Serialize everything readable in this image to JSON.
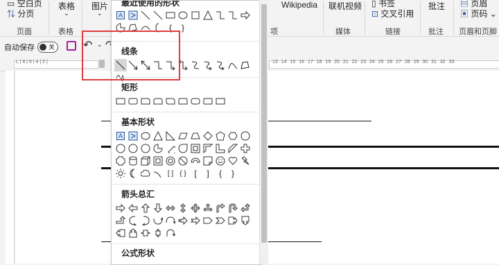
{
  "ribbon": {
    "page_group": {
      "item_top": "空白页",
      "item_split": "分页",
      "label": "页面"
    },
    "table": {
      "label_btn": "表格",
      "label": "表格"
    },
    "picture": {
      "label_btn": "图片"
    },
    "wiki": {
      "label": "Wikipedia"
    },
    "online_video": {
      "label": "联机视频",
      "group": "媒体"
    },
    "link": {
      "item_top": "书签",
      "item_cross": "交叉引用",
      "group": "链接"
    },
    "comment": {
      "label": "批注",
      "group": "批注"
    },
    "header_footer": {
      "item_top": "页眉",
      "item_page_no": "页码",
      "group": "页眉和页脚"
    },
    "items_group_label": "项"
  },
  "qat": {
    "autosave": "自动保存",
    "toggle_state": "关"
  },
  "ruler": {
    "left_ticks": "L | 8 | 6 | 4 | 2 |",
    "right_ticks": "13 14 15 16 17 18 19 20 21 22 23 24 25 26 27 28 29 30 31 32 33"
  },
  "shape_menu": {
    "sections": [
      {
        "title": "最近使用的形状"
      },
      {
        "title": "线条"
      },
      {
        "title": "矩形"
      },
      {
        "title": "基本形状"
      },
      {
        "title": "箭头总汇"
      },
      {
        "title": "公式形状"
      }
    ],
    "textbox_glyph": "A",
    "braces_glyph": "{ }",
    "brackets_glyph": "[ ]"
  },
  "colors": {
    "highlight": "#e03a3a",
    "accent": "#2b579a",
    "ribbon_bg": "#f3f3f3"
  }
}
